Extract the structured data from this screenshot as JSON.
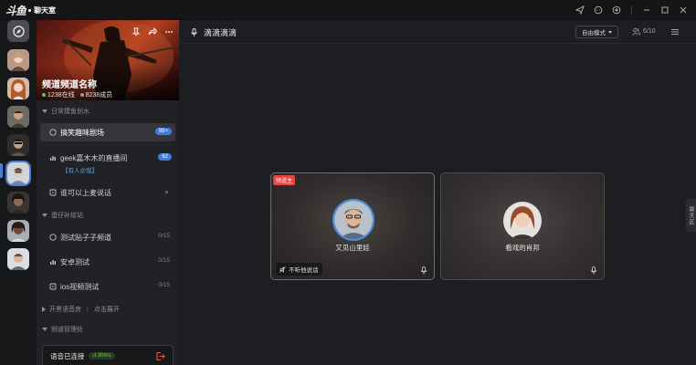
{
  "app": {
    "logo_text": "斗鱼",
    "logo_subtitle": "聊天室"
  },
  "colors": {
    "accent": "#3d7de0",
    "host_tag": "#e8443f",
    "latency": "#79c24f",
    "exit": "#e8593c"
  },
  "title_bar": {
    "icons": [
      "send-icon",
      "chat-icon",
      "record-icon",
      "minimize-icon",
      "maximize-icon",
      "close-icon"
    ]
  },
  "channel": {
    "name": "频道频道名称",
    "online": "1238在线",
    "members": "8238成员"
  },
  "groups": [
    {
      "name": "日常摸鱼划水",
      "expanded": true
    },
    {
      "name": "蛋仔补给站",
      "expanded": true
    },
    {
      "name": "开黑语音房",
      "expanded": false,
      "action": "点击展开"
    },
    {
      "name": "频道管理处",
      "expanded": true
    }
  ],
  "channels": [
    {
      "name": "搞笑趣味剧场",
      "icon": "chat-icon",
      "badge": "99+",
      "active": true
    },
    {
      "name": "geek嘉木木的直播间",
      "icon": "live-icon",
      "badge": "62",
      "sub": "【有人@我】"
    },
    {
      "name": "谁可以上麦说话",
      "icon": "voice-room-icon"
    },
    {
      "name": "测试贴子子频道",
      "icon": "chat-icon",
      "count": "0/15"
    },
    {
      "name": "安卓测试",
      "icon": "live-icon",
      "count": "0/15"
    },
    {
      "name": "ios视频测试",
      "icon": "voice-room-icon",
      "count": "0/15"
    }
  ],
  "voice_status": {
    "label": "语音已连接",
    "latency": "30ms"
  },
  "main": {
    "room_title": "滴滴滴滴",
    "mode": "自由模式",
    "member_count": "6/10",
    "side_tab": "聊天区"
  },
  "participants": [
    {
      "name": "又见山里娃",
      "tag": "频道主",
      "status": "不听他说话"
    },
    {
      "name": "看戏的肖邦"
    }
  ]
}
